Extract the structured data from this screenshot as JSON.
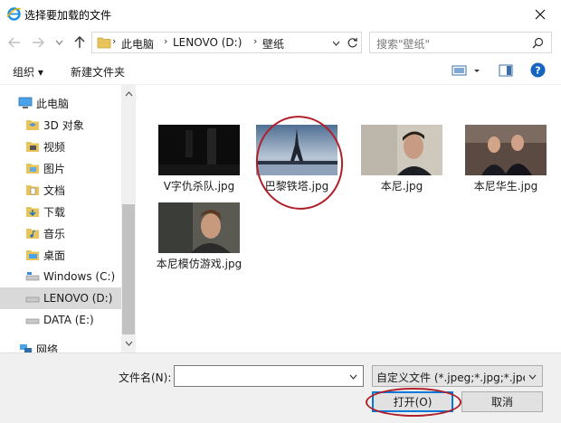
{
  "window": {
    "title": "选择要加载的文件",
    "app_icon": "internet-explorer-icon",
    "close_icon": "close-icon"
  },
  "navbar": {
    "breadcrumb": [
      "此电脑",
      "LENOVO (D:)",
      "壁纸"
    ],
    "search_placeholder": "搜索\"壁纸\"",
    "icons": [
      "back-arrow-icon",
      "forward-arrow-icon",
      "chevron-down-icon",
      "up-arrow-icon",
      "folder-icon",
      "refresh-icon",
      "search-icon"
    ]
  },
  "toolbar": {
    "organize_label": "组织 ▾",
    "new_folder_label": "新建文件夹",
    "icons": [
      "view-options-icon",
      "preview-pane-icon",
      "help-icon"
    ]
  },
  "sidebar": {
    "items": [
      {
        "label": "此电脑",
        "icon": "computer-icon"
      },
      {
        "label": "3D 对象",
        "icon": "3d-objects-icon"
      },
      {
        "label": "视频",
        "icon": "video-folder-icon"
      },
      {
        "label": "图片",
        "icon": "pictures-folder-icon"
      },
      {
        "label": "文档",
        "icon": "documents-folder-icon"
      },
      {
        "label": "下载",
        "icon": "downloads-folder-icon"
      },
      {
        "label": "音乐",
        "icon": "music-folder-icon"
      },
      {
        "label": "桌面",
        "icon": "desktop-folder-icon"
      },
      {
        "label": "Windows (C:)",
        "icon": "drive-icon"
      },
      {
        "label": "LENOVO (D:)",
        "icon": "drive-icon",
        "selected": true
      },
      {
        "label": "DATA (E:)",
        "icon": "drive-icon"
      },
      {
        "label": "网络",
        "icon": "network-icon"
      }
    ]
  },
  "files": [
    {
      "name": "V字仇杀队.jpg",
      "annotated": false
    },
    {
      "name": "巴黎铁塔.jpg",
      "annotated": true
    },
    {
      "name": "本尼.jpg",
      "annotated": false
    },
    {
      "name": "本尼华生.jpg",
      "annotated": false
    },
    {
      "name": "本尼模仿游戏.jpg",
      "annotated": false
    }
  ],
  "bottom": {
    "filename_label": "文件名(N):",
    "filename_value": "",
    "filter_value": "自定义文件 (*.jpeg;*.jpg;*.jpe;*",
    "open_label": "打开(O)",
    "cancel_label": "取消"
  },
  "colors": {
    "accent": "#0078d7",
    "annotation": "#b0202a",
    "selected_bg": "#d9d9d9"
  }
}
